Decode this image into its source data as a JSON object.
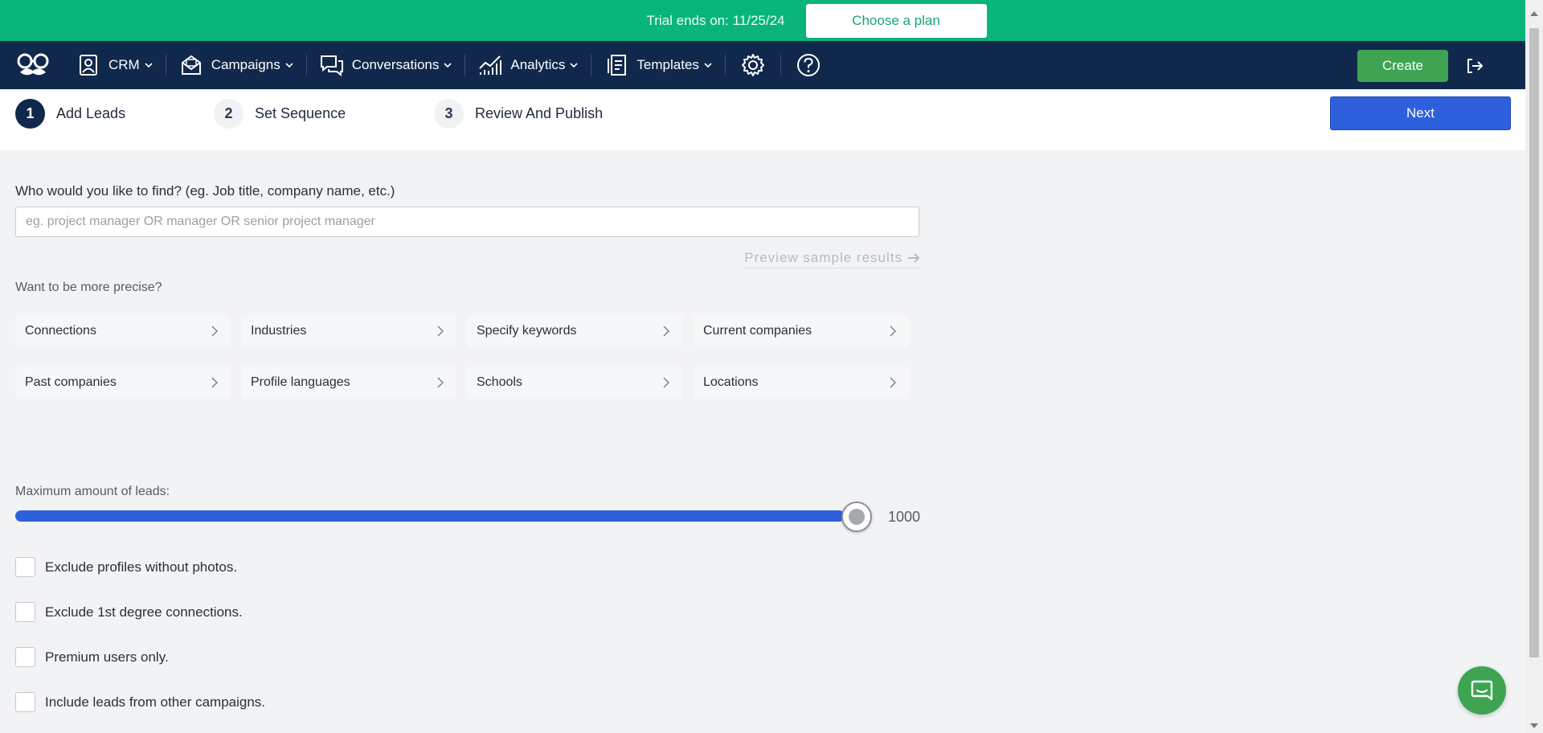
{
  "trial_banner": {
    "text": "Trial ends on: 11/25/24",
    "choose_plan_label": "Choose a plan"
  },
  "nav": {
    "logo_icon": "mustache-glasses-logo-icon",
    "items": [
      {
        "label": "CRM",
        "icon": "contact-card-icon"
      },
      {
        "label": "Campaigns",
        "icon": "envelope-icon"
      },
      {
        "label": "Conversations",
        "icon": "chat-bubbles-icon"
      },
      {
        "label": "Analytics",
        "icon": "analytics-chart-icon"
      },
      {
        "label": "Templates",
        "icon": "document-icon"
      }
    ],
    "settings_icon": "gear-icon",
    "help_icon": "help-circle-icon",
    "create_label": "Create",
    "logout_icon": "logout-icon"
  },
  "steps": [
    {
      "number": "1",
      "label": "Add Leads",
      "active": true
    },
    {
      "number": "2",
      "label": "Set Sequence",
      "active": false
    },
    {
      "number": "3",
      "label": "Review And Publish",
      "active": false
    }
  ],
  "next_label": "Next",
  "search": {
    "label": "Who would you like to find? (eg. Job title, company name, etc.)",
    "placeholder": "eg. project manager OR manager OR senior project manager",
    "value": "",
    "preview_label": "Preview sample results"
  },
  "precise_label": "Want to be more precise?",
  "filters": [
    "Connections",
    "Industries",
    "Specify keywords",
    "Current companies",
    "Past companies",
    "Profile languages",
    "Schools",
    "Locations"
  ],
  "max_leads": {
    "label": "Maximum amount of leads:",
    "value": "1000",
    "fill_fraction": 1.0
  },
  "checkboxes": [
    {
      "label": "Exclude profiles without photos.",
      "checked": false
    },
    {
      "label": "Exclude 1st degree connections.",
      "checked": false
    },
    {
      "label": "Premium users only.",
      "checked": false
    },
    {
      "label": "Include leads from other campaigns.",
      "checked": false
    }
  ],
  "chat_icon": "chat-widget-icon",
  "colors": {
    "trial_green": "#0ab57c",
    "nav_navy": "#10284b",
    "primary_blue": "#2e5fdc",
    "create_green": "#3fa452"
  }
}
